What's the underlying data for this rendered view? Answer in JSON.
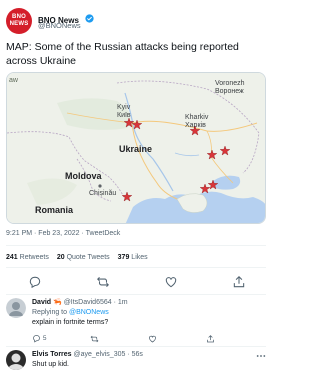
{
  "tweet": {
    "avatar_text": [
      "BNO",
      "NEWS"
    ],
    "author_name": "BNO News",
    "author_handle": "@BNONews",
    "text": "MAP: Some of the Russian attacks being reported across Ukraine",
    "timestamp": "9:21 PM · Feb 23, 2022 · ",
    "source": "TweetDeck",
    "stats": {
      "retweets": "241",
      "retweets_label": "Retweets",
      "quotes": "20",
      "quotes_label": "Quote Tweets",
      "likes": "379",
      "likes_label": "Likes"
    }
  },
  "map": {
    "labels": {
      "aw": "aw",
      "voronezh": "Voronezh",
      "voronezh_cyr": "Воронеж",
      "kyiv": "Kyiv",
      "kyiv_cyr": "Київ",
      "kharkiv": "Kharkiv",
      "kharkiv_cyr": "Харків",
      "ukraine": "Ukraine",
      "moldova": "Moldova",
      "chisinau": "Chișinău",
      "romania": "Romania"
    },
    "colors": {
      "land": "#eef1ea",
      "sea": "#b5d0f0",
      "star": "#d8363a",
      "road": "#f4c87c"
    }
  },
  "replies": [
    {
      "name": "David",
      "emoji": "🦐",
      "handle": "@ItsDavid6564",
      "time": "1m",
      "replying_to_label": "Replying to ",
      "replying_to": "@BNONews",
      "text": "explain in fortnite terms?",
      "reply_count": "5"
    },
    {
      "name": "Elvis Torres",
      "handle": "@aye_elvis_305",
      "time": "56s",
      "text": "Shut up kid."
    }
  ],
  "icons": [
    "verified-badge-icon",
    "reply-icon",
    "retweet-icon",
    "like-icon",
    "share-icon",
    "more-icon"
  ]
}
